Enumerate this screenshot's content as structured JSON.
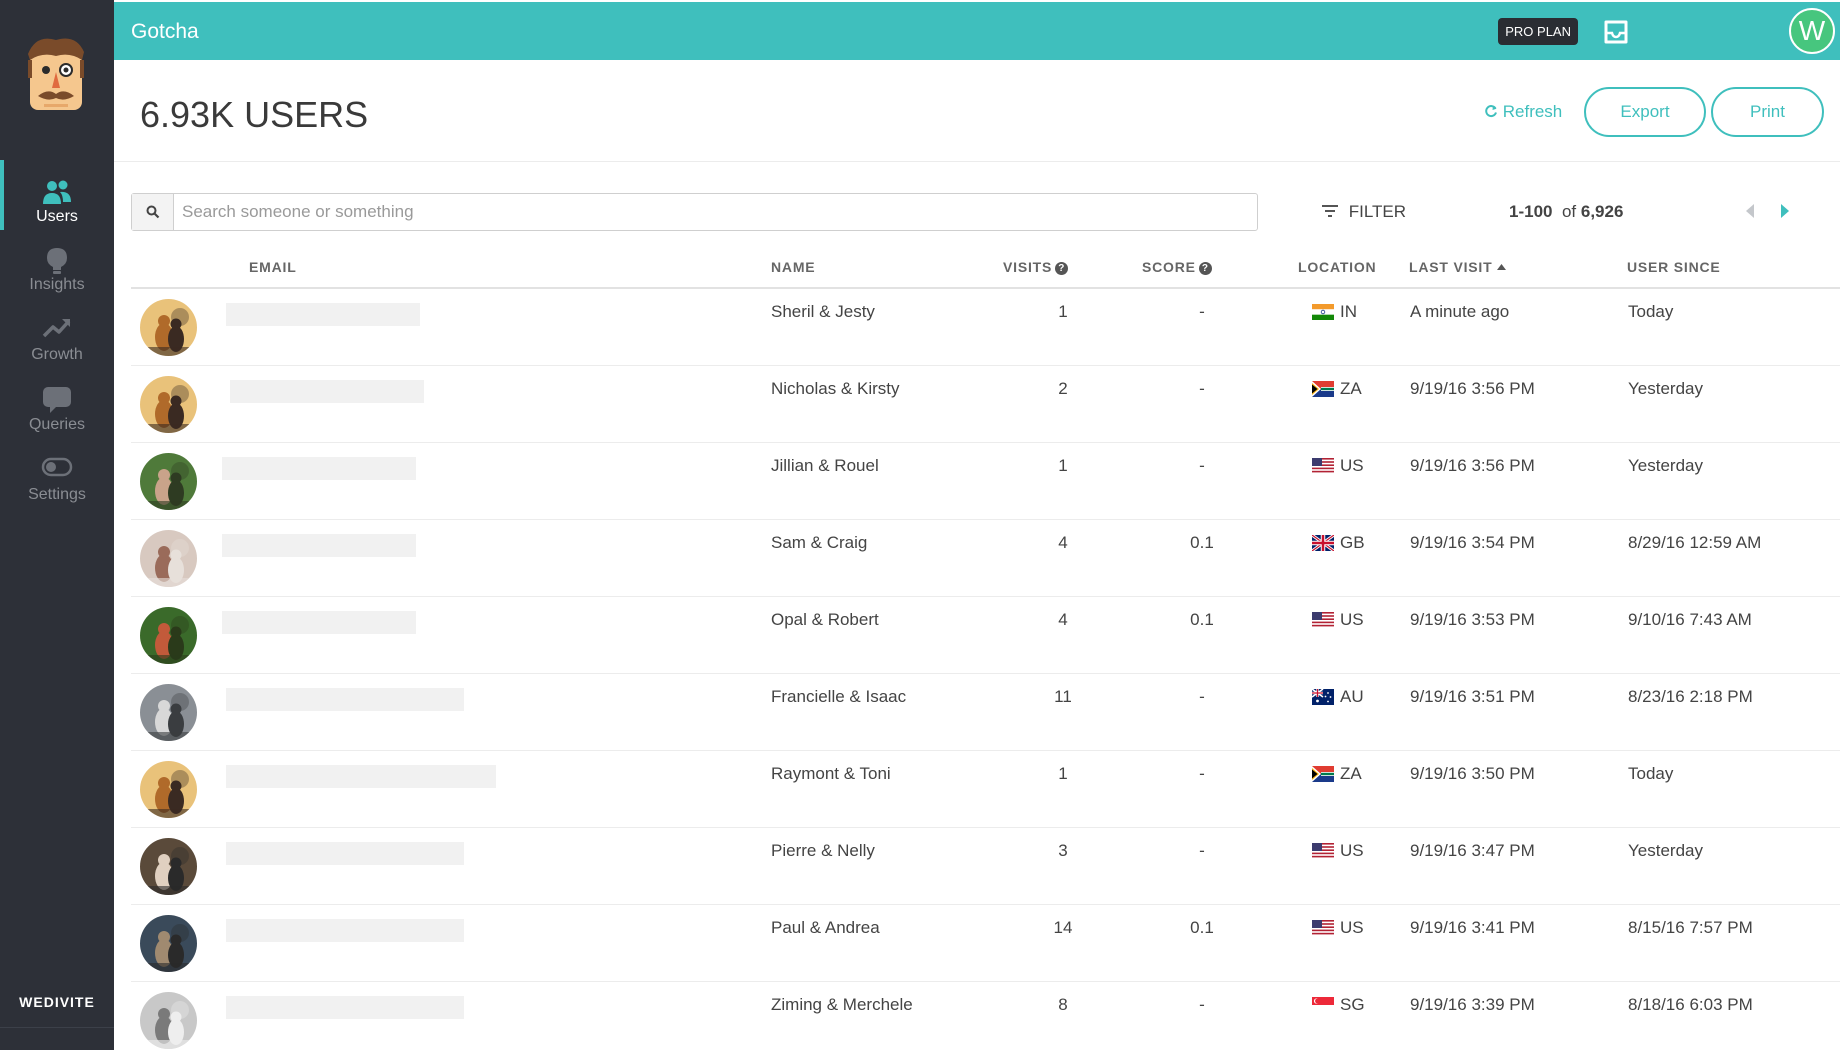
{
  "app": {
    "title": "Gotcha",
    "plan_badge": "PRO PLAN",
    "user_initial": "W",
    "brand": "WEDIVITE"
  },
  "colors": {
    "accent": "#3fbfbd",
    "sidebar": "#2d3038",
    "avatar_green": "#47c67e"
  },
  "sidebar": {
    "items": [
      {
        "label": "Users",
        "icon": "users-icon",
        "active": true
      },
      {
        "label": "Insights",
        "icon": "lightbulb-icon",
        "active": false
      },
      {
        "label": "Growth",
        "icon": "trend-up-icon",
        "active": false
      },
      {
        "label": "Queries",
        "icon": "chat-bubble-icon",
        "active": false
      },
      {
        "label": "Settings",
        "icon": "toggle-icon",
        "active": false
      }
    ]
  },
  "header": {
    "title": "6.93K USERS",
    "refresh_label": "Refresh",
    "export_label": "Export",
    "print_label": "Print"
  },
  "search": {
    "placeholder": "Search someone or something",
    "value": ""
  },
  "filter": {
    "label": "FILTER"
  },
  "pager": {
    "range": "1-100",
    "of_label": "of",
    "total": "6,926"
  },
  "table": {
    "columns": {
      "email": "EMAIL",
      "name": "NAME",
      "visits": "VISITS",
      "score": "SCORE",
      "location": "LOCATION",
      "last_visit": "LAST VISIT",
      "user_since": "USER SINCE"
    },
    "sort": {
      "column": "last_visit",
      "direction": "ascending-arrow"
    },
    "rows": [
      {
        "name": "Sheril & Jesty",
        "visits": "1",
        "score": "-",
        "country": "IN",
        "last_visit": "A minute ago",
        "user_since": "Today"
      },
      {
        "name": "Nicholas & Kirsty",
        "visits": "2",
        "score": "-",
        "country": "ZA",
        "last_visit": "9/19/16 3:56 PM",
        "user_since": "Yesterday"
      },
      {
        "name": "Jillian & Rouel",
        "visits": "1",
        "score": "-",
        "country": "US",
        "last_visit": "9/19/16 3:56 PM",
        "user_since": "Yesterday"
      },
      {
        "name": "Sam & Craig",
        "visits": "4",
        "score": "0.1",
        "country": "GB",
        "last_visit": "9/19/16 3:54 PM",
        "user_since": "8/29/16 12:59 AM"
      },
      {
        "name": "Opal & Robert",
        "visits": "4",
        "score": "0.1",
        "country": "US",
        "last_visit": "9/19/16 3:53 PM",
        "user_since": "9/10/16 7:43 AM"
      },
      {
        "name": "Francielle & Isaac",
        "visits": "11",
        "score": "-",
        "country": "AU",
        "last_visit": "9/19/16 3:51 PM",
        "user_since": "8/23/16 2:18 PM"
      },
      {
        "name": "Raymont & Toni",
        "visits": "1",
        "score": "-",
        "country": "ZA",
        "last_visit": "9/19/16 3:50 PM",
        "user_since": "Today"
      },
      {
        "name": "Pierre & Nelly",
        "visits": "3",
        "score": "-",
        "country": "US",
        "last_visit": "9/19/16 3:47 PM",
        "user_since": "Yesterday"
      },
      {
        "name": "Paul & Andrea",
        "visits": "14",
        "score": "0.1",
        "country": "US",
        "last_visit": "9/19/16 3:41 PM",
        "user_since": "8/15/16 7:57 PM"
      },
      {
        "name": "Ziming & Merchele",
        "visits": "8",
        "score": "-",
        "country": "SG",
        "last_visit": "9/19/16 3:39 PM",
        "user_since": "8/18/16 6:03 PM"
      }
    ]
  }
}
